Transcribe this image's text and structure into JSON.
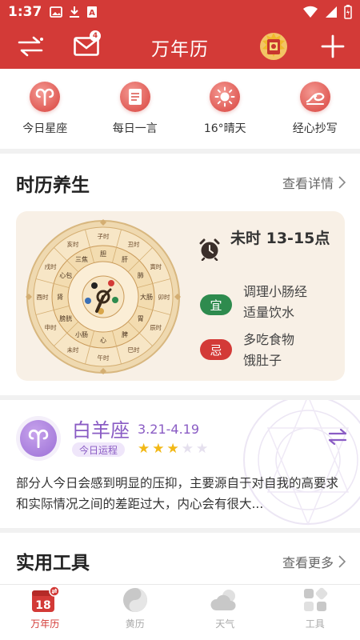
{
  "status_bar": {
    "time": "1:37"
  },
  "app_bar": {
    "title": "万年历",
    "mail_badge": "4"
  },
  "quick_actions": [
    {
      "label": "今日星座",
      "icon": "aries-icon"
    },
    {
      "label": "每日一言",
      "icon": "book-icon"
    },
    {
      "label": "16°晴天",
      "icon": "sun-icon"
    },
    {
      "label": "经心抄写",
      "icon": "scroll-icon"
    }
  ],
  "almanac": {
    "title": "时历养生",
    "link": "查看详情",
    "hour": "未时 13-15点",
    "good_tag": "宜",
    "good": [
      "调理小肠经",
      "适量饮水"
    ],
    "bad_tag": "忌",
    "bad": [
      "多吃食物",
      "饿肚子"
    ],
    "dial": {
      "branches": [
        "子时",
        "丑时",
        "寅时",
        "卯时",
        "辰时",
        "巳时",
        "午时",
        "未时",
        "申时",
        "酉时",
        "戌时",
        "亥时"
      ],
      "organs": [
        "胆",
        "肝",
        "肺",
        "大肠",
        "胃",
        "脾",
        "心",
        "小肠",
        "膀胱",
        "肾",
        "心包",
        "三焦"
      ]
    }
  },
  "zodiac": {
    "name": "白羊座",
    "dates": "3.21-4.19",
    "tag": "今日运程",
    "stars_filled": 3,
    "stars_total": 5,
    "text": "部分人今日会感到明显的压抑，主要源自于对自我的高要求和实际情况之间的差距过大，内心会有很大..."
  },
  "tools": {
    "title": "实用工具",
    "link": "查看更多"
  },
  "bottom_nav": [
    {
      "label": "万年历",
      "date": "18",
      "active": true
    },
    {
      "label": "黄历",
      "active": false
    },
    {
      "label": "天气",
      "active": false
    },
    {
      "label": "工具",
      "active": false
    }
  ],
  "colors": {
    "brand_red": "#d33a37",
    "purple": "#8a5cc4",
    "good_green": "#2e8b4e",
    "star_gold": "#f2b816"
  }
}
